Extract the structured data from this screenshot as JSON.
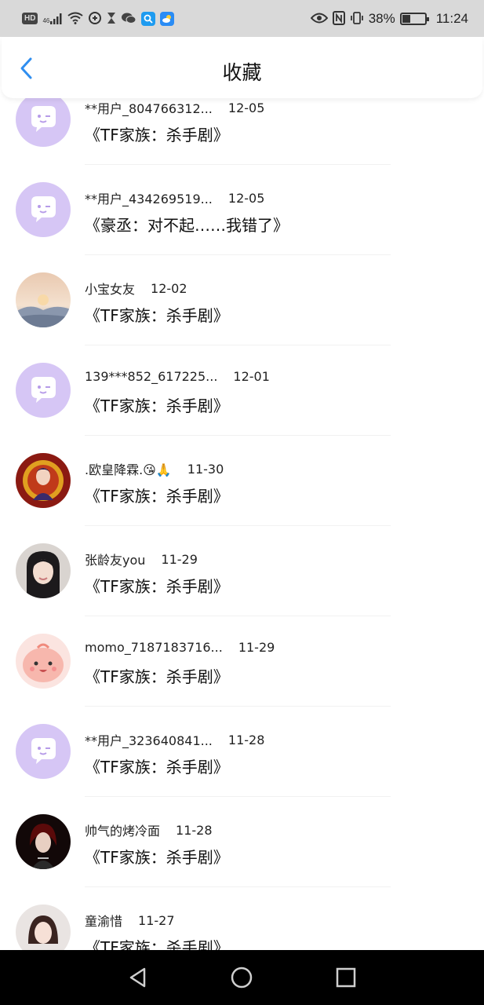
{
  "status_bar": {
    "hd": "HD",
    "signal": "46",
    "battery_percent": "38%",
    "battery_level": 0.38,
    "time": "11:24"
  },
  "header": {
    "title": "收藏",
    "back_icon": "chevron-left-icon"
  },
  "colors": {
    "accent": "#2f8ef0",
    "default_avatar_bg": "#d6c6f5",
    "default_avatar_fg": "#ffffff",
    "status_bar_bg": "#d9d9d9",
    "nav_bar_bg": "#000000"
  },
  "favorites": [
    {
      "user": "**用户_804766312...",
      "date": "12-05",
      "title": "《TF家族：杀手剧》",
      "avatar": "default-chat-avatar"
    },
    {
      "user": "**用户_434269519...",
      "date": "12-05",
      "title": "《豪丞：对不起……我错了》",
      "avatar": "default-chat-avatar"
    },
    {
      "user": "小宝女友",
      "date": "12-02",
      "title": "《TF家族：杀手剧》",
      "avatar": "landscape-avatar"
    },
    {
      "user": "139***852_617225...",
      "date": "12-01",
      "title": "《TF家族：杀手剧》",
      "avatar": "default-chat-avatar"
    },
    {
      "user": ".欧皇降霖.😘🙏",
      "date": "11-30",
      "title": "《TF家族：杀手剧》",
      "avatar": "portrait-red-avatar"
    },
    {
      "user": "张龄友you",
      "date": "11-29",
      "title": "《TF家族：杀手剧》",
      "avatar": "portrait-girl-avatar"
    },
    {
      "user": "momo_7187183716...",
      "date": "11-29",
      "title": "《TF家族：杀手剧》",
      "avatar": "pink-cartoon-avatar"
    },
    {
      "user": "**用户_323640841...",
      "date": "11-28",
      "title": "《TF家族：杀手剧》",
      "avatar": "default-chat-avatar"
    },
    {
      "user": "帅气的烤冷面",
      "date": "11-28",
      "title": "《TF家族：杀手剧》",
      "avatar": "portrait-dark-avatar"
    },
    {
      "user": "童渝惜",
      "date": "11-27",
      "title": "《TF家族：杀手剧》",
      "avatar": "portrait-red-girl-avatar"
    }
  ],
  "nav_bar": {
    "back": "triangle-back-icon",
    "home": "circle-home-icon",
    "recents": "square-recents-icon"
  }
}
